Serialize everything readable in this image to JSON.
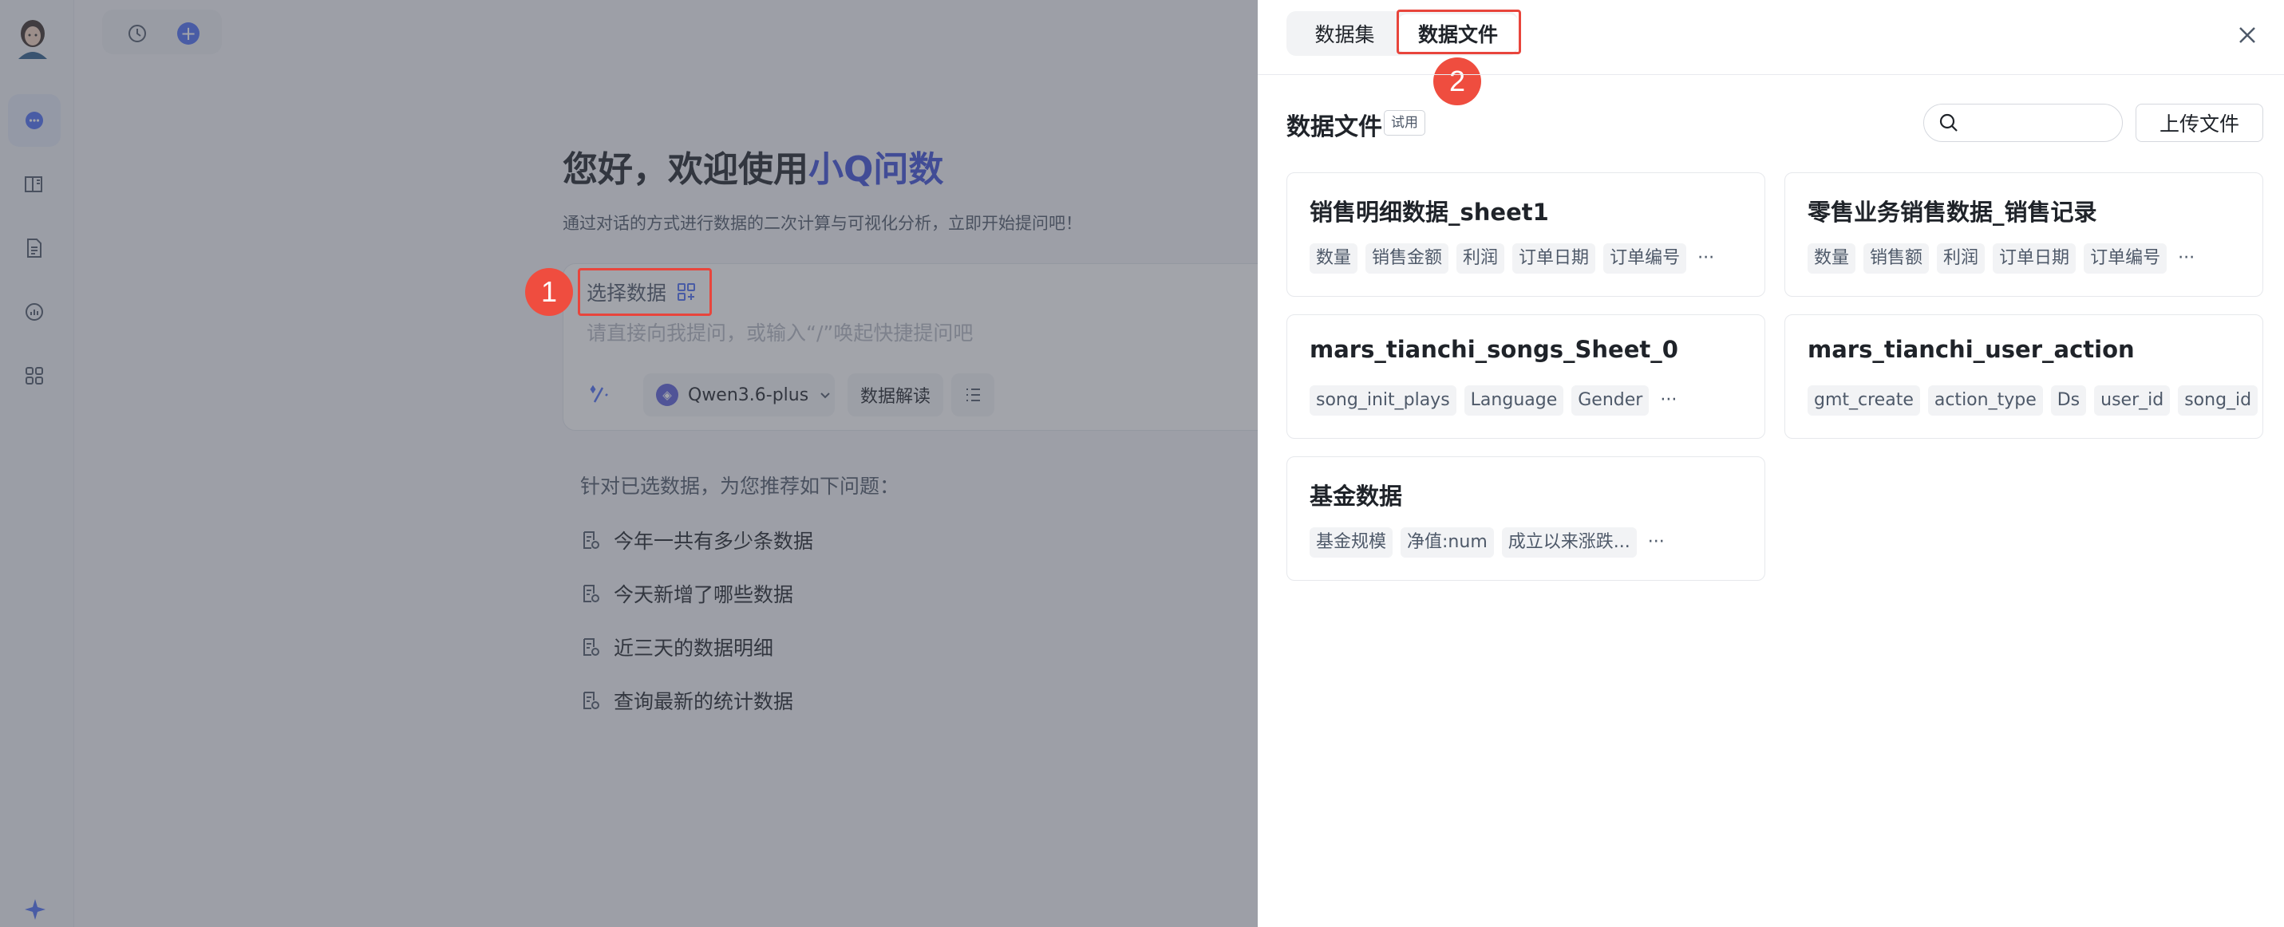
{
  "sidebar": {
    "items": [
      {
        "icon": "chat-icon",
        "active": true
      },
      {
        "icon": "book-icon",
        "active": false
      },
      {
        "icon": "document-icon",
        "active": false
      },
      {
        "icon": "analytics-icon",
        "active": false
      },
      {
        "icon": "apps-grid-icon",
        "active": false
      }
    ],
    "bottom_icon": "sparkle-icon"
  },
  "main": {
    "welcome_prefix": "您好，欢迎使用",
    "brand": "小Q问数",
    "subtitle": "通过对话的方式进行数据的二次计算与可视化分析，立即开始提问吧！",
    "select_data_label": "选择数据",
    "input_placeholder": "请直接向我提问，或输入“/”唤起快捷提问吧",
    "model_name": "Qwen3.6-plus",
    "interpret_label": "数据解读",
    "recommend_title": "针对已选数据，为您推荐如下问题：",
    "recommendations": [
      "今年一共有多少条数据",
      "今天新增了哪些数据",
      "近三天的数据明细",
      "查询最新的统计数据"
    ]
  },
  "steps": {
    "one": "1",
    "two": "2"
  },
  "drawer": {
    "tabs": [
      "数据集",
      "数据文件"
    ],
    "section_title": "数据文件",
    "trial_badge": "试用",
    "search_placeholder": "",
    "upload_label": "上传文件",
    "cards": [
      {
        "title": "销售明细数据_sheet1",
        "tags": [
          "数量",
          "销售金额",
          "利润",
          "订单日期",
          "订单编号"
        ]
      },
      {
        "title": "零售业务销售数据_销售记录",
        "tags": [
          "数量",
          "销售额",
          "利润",
          "订单日期",
          "订单编号"
        ]
      },
      {
        "title": "mars_tianchi_songs_Sheet_0",
        "tags": [
          "song_init_plays",
          "Language",
          "Gender"
        ]
      },
      {
        "title": "mars_tianchi_user_action",
        "tags": [
          "gmt_create",
          "action_type",
          "Ds",
          "user_id",
          "song_id"
        ]
      },
      {
        "title": "基金数据",
        "tags": [
          "基金规模",
          "净值:num",
          "成立以来涨跌..."
        ]
      }
    ],
    "more_glyph": "···"
  },
  "colors": {
    "accent": "#4c6ef5",
    "brand": "#3d4fd6",
    "callout": "#e8453c"
  }
}
